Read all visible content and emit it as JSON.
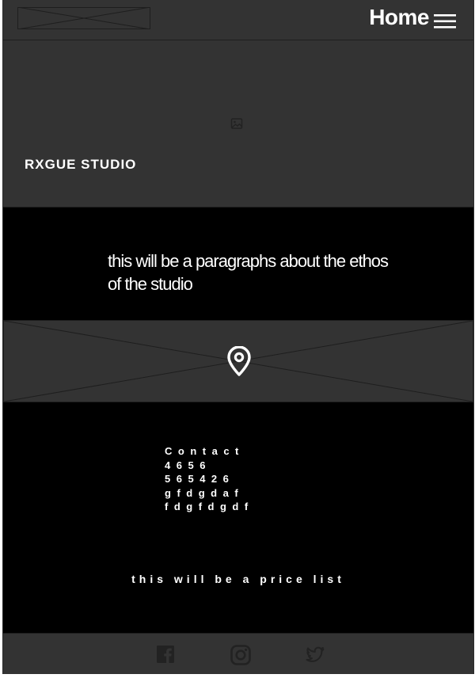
{
  "header": {
    "nav_label": "Home"
  },
  "hero": {
    "title": "RXGUE STUDIO"
  },
  "ethos": {
    "text": "this will be a paragraphs about the ethos of the studio"
  },
  "contact": {
    "lines": [
      "Contact",
      "4656",
      "565426",
      "gfdgdaf",
      "fdgfdgdf"
    ]
  },
  "price": {
    "text": "this will be a price list"
  },
  "footer": {
    "icons": [
      "facebook-icon",
      "instagram-icon",
      "twitter-icon"
    ]
  },
  "colors": {
    "panel": "#333333",
    "background": "#000000",
    "text": "#ffffff",
    "icon_muted": "#222222"
  }
}
